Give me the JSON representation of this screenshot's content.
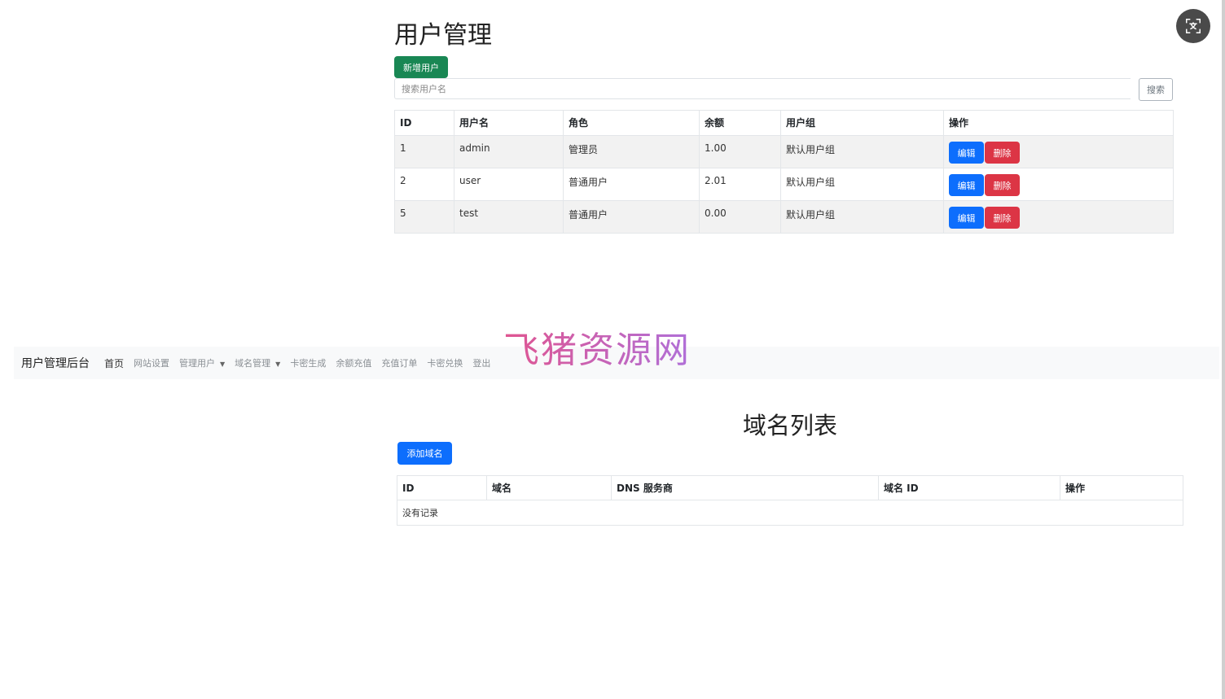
{
  "users_panel": {
    "title": "用户管理",
    "add_button": "新增用户",
    "search_placeholder": "搜索用户名",
    "search_button": "搜索",
    "columns": [
      "ID",
      "用户名",
      "角色",
      "余额",
      "用户组",
      "操作"
    ],
    "rows": [
      {
        "id": "1",
        "username": "admin",
        "role": "管理员",
        "balance": "1.00",
        "group": "默认用户组"
      },
      {
        "id": "2",
        "username": "user",
        "role": "普通用户",
        "balance": "2.01",
        "group": "默认用户组"
      },
      {
        "id": "5",
        "username": "test",
        "role": "普通用户",
        "balance": "0.00",
        "group": "默认用户组"
      }
    ],
    "edit_label": "编辑",
    "delete_label": "删除"
  },
  "navbar": {
    "brand": "用户管理后台",
    "items": [
      "首页",
      "网站设置",
      "管理用户",
      "域名管理",
      "卡密生成",
      "余额充值",
      "充值订单",
      "卡密兑换",
      "登出"
    ],
    "active": "首页",
    "dropdown_items": [
      "管理用户",
      "域名管理"
    ]
  },
  "watermark": "飞猪资源网",
  "domains_panel": {
    "title": "域名列表",
    "add_button": "添加域名",
    "columns": [
      "ID",
      "域名",
      "DNS 服务商",
      "域名 ID",
      "操作"
    ],
    "empty_text": "没有记录"
  },
  "colors": {
    "success": "#198754",
    "primary": "#0d6efd",
    "danger": "#dc3545",
    "navbar_bg": "#f8f9fa"
  },
  "icons": {
    "translate": "translate-icon"
  }
}
